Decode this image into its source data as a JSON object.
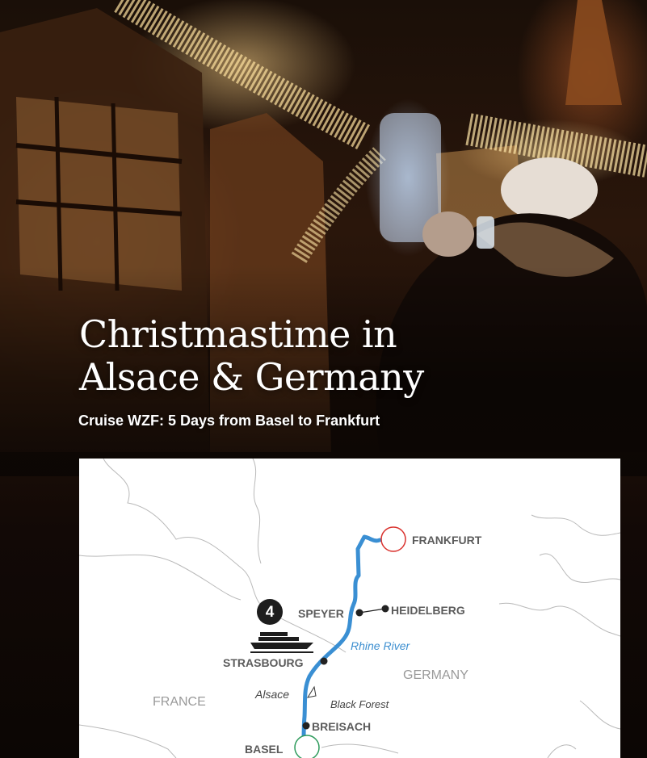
{
  "hero": {
    "title_line1": "Christmastime in",
    "title_line2": "Alsace & Germany",
    "subtitle": "Cruise WZF: 5 Days from Basel to Frankfurt"
  },
  "map": {
    "cities": {
      "frankfurt": "FRANKFURT",
      "heidelberg": "HEIDELBERG",
      "speyer": "SPEYER",
      "strasbourg": "STRASBOURG",
      "breisach": "BREISACH",
      "basel": "BASEL"
    },
    "countries": {
      "germany": "GERMANY",
      "france": "FRANCE"
    },
    "regions": {
      "alsace": "Alsace",
      "black_forest": "Black Forest"
    },
    "river": "Rhine River",
    "ship_badge": "4",
    "colors": {
      "route": "#3a8fd3",
      "end_port": "#d9302c",
      "start_port": "#2e9b5c"
    }
  }
}
